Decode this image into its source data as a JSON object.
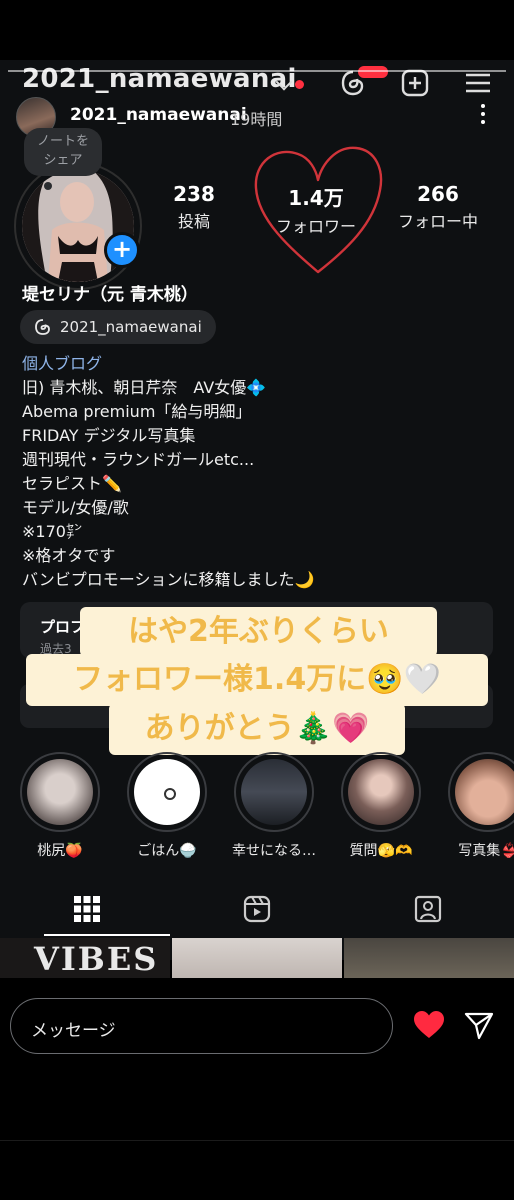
{
  "header": {
    "username": "2021_namaewanai"
  },
  "story": {
    "username": "2021_namaewanai",
    "time": "19時間",
    "note_line1": "ノートを",
    "note_line2": "シェア"
  },
  "stats": [
    {
      "num": "238",
      "label": "投稿"
    },
    {
      "num": "1.4万",
      "label": "フォロワー"
    },
    {
      "num": "266",
      "label": "フォロー中"
    }
  ],
  "profile": {
    "display_name": "堤セリナ（元 青木桃）",
    "threads_handle": "2021_namaewanai",
    "bio": [
      "個人ブログ",
      "旧) 青木桃、朝日芹奈　AV女優💠",
      "Abema premium「給与明細」",
      "FRIDAY デジタル写真集",
      "週刊現代・ラウンドガールetc...",
      "セラピスト✏️",
      "モデル/女優/歌",
      "※170㌢",
      "※格オタです",
      "バンビプロモーションに移籍しました🌙"
    ],
    "pro_title": "プロフ",
    "pro_sub": "過去3"
  },
  "sticker": {
    "line1": "はや2年ぶりくらい",
    "line2": "フォロワー様1.4万に🥹🤍",
    "line3": "ありがとう🎄💗"
  },
  "highlights": [
    {
      "label": "桃尻🍑",
      "color": "#8a8080"
    },
    {
      "label": "ごはん🍚",
      "color": "#ffffff"
    },
    {
      "label": "幸せになる…",
      "color": "#3a3e48"
    },
    {
      "label": "質問🫣🫶",
      "color": "#5a4a48"
    },
    {
      "label": "写真集👙",
      "color": "#b08a78"
    }
  ],
  "grid_preview": {
    "tile1_text": "VIBES"
  },
  "reply": {
    "placeholder": "メッセージ"
  },
  "colors": {
    "accent_blue": "#1e90ff",
    "heart_red": "#ff3040",
    "sticker_bg": "#fdf2d6",
    "sticker_text": "#f0b94a"
  }
}
